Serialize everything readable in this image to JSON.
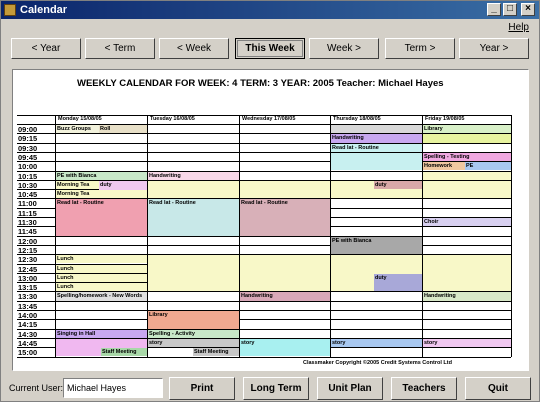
{
  "window": {
    "title": "Calendar"
  },
  "menu": {
    "help": "Help"
  },
  "nav": [
    "< Year",
    "< Term",
    "< Week",
    "This Week",
    "Week >",
    "Term >",
    "Year >"
  ],
  "heading": "WEEKLY CALENDAR FOR WEEK: 4 TERM: 3 YEAR: 2005    Teacher: Michael Hayes",
  "days": [
    "Monday 15/08/05",
    "Tuesday 16/08/05",
    "Wednesday 17/08/05",
    "Thursday 18/08/05",
    "Friday 19/08/05"
  ],
  "times": [
    "09:00",
    "09:15",
    "09:30",
    "09:45",
    "10:00",
    "10:15",
    "10:30",
    "10:45",
    "11:00",
    "11:15",
    "11:30",
    "11:45",
    "12:00",
    "12:15",
    "12:30",
    "12:45",
    "13:00",
    "13:15",
    "13:30",
    "13:45",
    "14:00",
    "14:15",
    "14:30",
    "14:45",
    "15:00"
  ],
  "events": [
    {
      "day": 0,
      "row": 0,
      "len": 1,
      "text": "Buzz Groups",
      "color": "#f2f2dc"
    },
    {
      "day": 0,
      "row": 0,
      "len": 1,
      "text": "Roll",
      "color": "#e8e0c8",
      "sub": "r"
    },
    {
      "day": 3,
      "row": 0,
      "len": 1,
      "text": "",
      "color": "#d8d8d8"
    },
    {
      "day": 4,
      "row": 0,
      "len": 1,
      "text": "Library",
      "color": "#d8f0c8"
    },
    {
      "day": 3,
      "row": 1,
      "len": 1,
      "text": "Handwriting",
      "color": "#c8a8f0"
    },
    {
      "day": 4,
      "row": 1,
      "len": 1,
      "text": "",
      "color": "#e8f4a0"
    },
    {
      "day": 3,
      "row": 2,
      "len": 1,
      "text": "Read lat - Routine",
      "color": "#c8f0f0"
    },
    {
      "day": 3,
      "row": 3,
      "len": 2,
      "text": "",
      "color": "#c8f0f0"
    },
    {
      "day": 4,
      "row": 3,
      "len": 1,
      "text": "Spelling - Testing",
      "color": "#f0a8e0"
    },
    {
      "day": 4,
      "row": 4,
      "len": 1,
      "text": "Homework",
      "color": "#f0c8a0"
    },
    {
      "day": 4,
      "row": 4,
      "len": 1,
      "text": "PE",
      "color": "#a8c8f0",
      "sub": "r"
    },
    {
      "day": 4,
      "row": 5,
      "len": 1,
      "text": "",
      "color": "#f8f8c8"
    },
    {
      "day": 0,
      "row": 5,
      "len": 1,
      "text": "PE with Bianca",
      "color": "#c8e8c8"
    },
    {
      "day": 1,
      "row": 5,
      "len": 1,
      "text": "Handwriting",
      "color": "#f8d8e8"
    },
    {
      "day": 0,
      "row": 6,
      "len": 1,
      "text": "Morning Tea",
      "color": "#f8f8c8"
    },
    {
      "day": 0,
      "row": 6,
      "len": 2,
      "text": "duty",
      "color": "#f0c8f0",
      "sub": "r"
    },
    {
      "day": 1,
      "row": 6,
      "len": 2,
      "text": "",
      "color": "#f8f8c8"
    },
    {
      "day": 2,
      "row": 6,
      "len": 2,
      "text": "",
      "color": "#f8f8c8"
    },
    {
      "day": 3,
      "row": 6,
      "len": 2,
      "text": "",
      "color": "#f8f8c8"
    },
    {
      "day": 3,
      "row": 6,
      "len": 1,
      "text": "duty",
      "color": "#d8a8a8",
      "sub": "r"
    },
    {
      "day": 4,
      "row": 6,
      "len": 2,
      "text": "",
      "color": "#f8f8c8"
    },
    {
      "day": 0,
      "row": 7,
      "len": 1,
      "text": "Morning Tea",
      "color": "#f8f8c8"
    },
    {
      "day": 0,
      "row": 8,
      "len": 4,
      "text": "Read lat - Routine",
      "color": "#f0a0b0"
    },
    {
      "day": 1,
      "row": 8,
      "len": 4,
      "text": "Read lat - Routine",
      "color": "#c8e8e8"
    },
    {
      "day": 2,
      "row": 8,
      "len": 4,
      "text": "Read lat - Routine",
      "color": "#d8b0b8"
    },
    {
      "day": 4,
      "row": 10,
      "len": 1,
      "text": "Choir",
      "color": "#d8d0f0"
    },
    {
      "day": 3,
      "row": 12,
      "len": 2,
      "text": "PE with Bianca",
      "color": "#a8a8a8"
    },
    {
      "day": 0,
      "row": 14,
      "len": 1,
      "text": "Lunch",
      "color": "#f8f8c8"
    },
    {
      "day": 1,
      "row": 14,
      "len": 4,
      "text": "",
      "color": "#f8f8c8"
    },
    {
      "day": 2,
      "row": 14,
      "len": 4,
      "text": "",
      "color": "#f8f8c8"
    },
    {
      "day": 3,
      "row": 14,
      "len": 4,
      "text": "",
      "color": "#f8f8c8"
    },
    {
      "day": 4,
      "row": 14,
      "len": 4,
      "text": "",
      "color": "#f8f8c8"
    },
    {
      "day": 0,
      "row": 15,
      "len": 1,
      "text": "Lunch",
      "color": "#f8f8c8"
    },
    {
      "day": 0,
      "row": 16,
      "len": 1,
      "text": "Lunch",
      "color": "#f8f8c8"
    },
    {
      "day": 3,
      "row": 16,
      "len": 2,
      "text": "duty",
      "color": "#a8a8d8",
      "sub": "r"
    },
    {
      "day": 0,
      "row": 17,
      "len": 1,
      "text": "Lunch",
      "color": "#f8f8c8"
    },
    {
      "day": 0,
      "row": 18,
      "len": 1,
      "text": "Spelling/homework - New Words",
      "color": "#e0e0e0"
    },
    {
      "day": 2,
      "row": 18,
      "len": 1,
      "text": "Handwriting",
      "color": "#d8a8b8"
    },
    {
      "day": 4,
      "row": 18,
      "len": 1,
      "text": "Handwriting",
      "color": "#d8e8c8"
    },
    {
      "day": 1,
      "row": 20,
      "len": 2,
      "text": "Library",
      "color": "#f0a890"
    },
    {
      "day": 0,
      "row": 22,
      "len": 1,
      "text": "Singing in Hall",
      "color": "#c8a8f0"
    },
    {
      "day": 1,
      "row": 22,
      "len": 1,
      "text": "Spelling - Activity",
      "color": "#c8e8c8"
    },
    {
      "day": 0,
      "row": 23,
      "len": 2,
      "text": "",
      "color": "#f0b8f0"
    },
    {
      "day": 1,
      "row": 23,
      "len": 1,
      "text": "story",
      "color": "#c8c8c8"
    },
    {
      "day": 2,
      "row": 23,
      "len": 2,
      "text": "story",
      "color": "#a8f0f0"
    },
    {
      "day": 3,
      "row": 23,
      "len": 1,
      "text": "story",
      "color": "#a8c8f0"
    },
    {
      "day": 4,
      "row": 23,
      "len": 1,
      "text": "story",
      "color": "#f0c8f0"
    },
    {
      "day": 0,
      "row": 24,
      "len": 1,
      "text": "Staff Meeting",
      "color": "#a8d8a8",
      "sub": "m"
    },
    {
      "day": 1,
      "row": 24,
      "len": 1,
      "text": "Staff Meeting",
      "color": "#c8c8c8",
      "sub": "m"
    }
  ],
  "copyright": "Classmaker Copyright ©2005 Credit Systems Control Ltd",
  "user": {
    "label": "Current User:",
    "value": "Michael Hayes"
  },
  "actions": [
    "Print",
    "Long Term",
    "Unit Plan",
    "Teachers",
    "Quit"
  ]
}
